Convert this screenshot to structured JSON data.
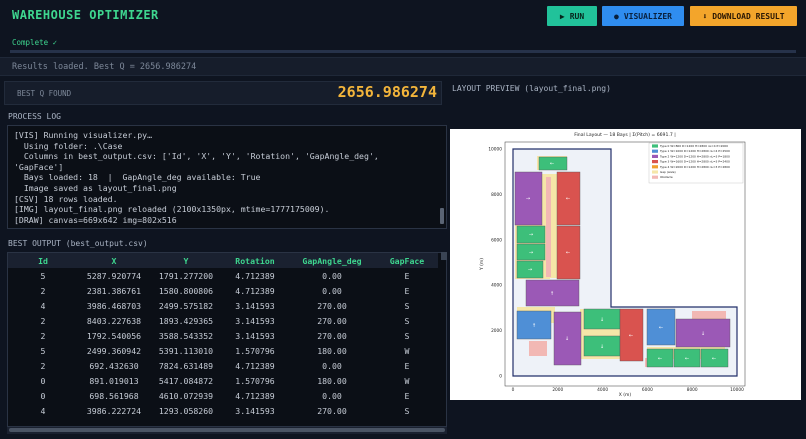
{
  "header": {
    "title": "WAREHOUSE OPTIMIZER",
    "run_label": "RUN",
    "visualizer_label": "VISUALIZER",
    "download_label": "DOWNLOAD RESULT"
  },
  "status": {
    "text": "Complete ✓",
    "progress": 1.0
  },
  "results_line": "Results loaded.  Best Q = 2656.986274",
  "best_q": {
    "label": "BEST Q FOUND",
    "value": "2656.986274"
  },
  "process_log": {
    "label": "PROCESS LOG",
    "lines": [
      "[VIS] Running visualizer.py…",
      "  Using folder: .\\Case",
      "  Columns in best_output.csv: ['Id', 'X', 'Y', 'Rotation', 'GapAngle_deg',",
      "'GapFace']",
      "  Bays loaded: 18  |  GapAngle_deg available: True",
      "  Image saved as layout_final.png",
      "[CSV] 18 rows loaded.",
      "[IMG] layout_final.png reloaded (2100x1350px, mtime=1777175009).",
      "[DRAW] canvas=669x642 img=802x516"
    ]
  },
  "best_output": {
    "label": "BEST OUTPUT  (best_output.csv)",
    "columns": [
      "Id",
      "X",
      "Y",
      "Rotation",
      "GapAngle_deg",
      "GapFace"
    ],
    "rows": [
      [
        "5",
        "5287.920774",
        "1791.277200",
        "4.712389",
        "0.00",
        "E"
      ],
      [
        "2",
        "2381.386761",
        "1580.800806",
        "4.712389",
        "0.00",
        "E"
      ],
      [
        "4",
        "3986.468703",
        "2499.575182",
        "3.141593",
        "270.00",
        "S"
      ],
      [
        "2",
        "8403.227638",
        "1893.429365",
        "3.141593",
        "270.00",
        "S"
      ],
      [
        "2",
        "1792.540056",
        "3588.543352",
        "3.141593",
        "270.00",
        "S"
      ],
      [
        "5",
        "2499.360942",
        "5391.113010",
        "1.570796",
        "180.00",
        "W"
      ],
      [
        "2",
        "692.432630",
        "7824.631489",
        "4.712389",
        "0.00",
        "E"
      ],
      [
        "0",
        "891.019013",
        "5417.084872",
        "1.570796",
        "180.00",
        "W"
      ],
      [
        "0",
        "698.561968",
        "4610.072939",
        "4.712389",
        "0.00",
        "E"
      ],
      [
        "4",
        "3986.222724",
        "1293.058260",
        "3.141593",
        "270.00",
        "S"
      ]
    ]
  },
  "preview": {
    "label": "LAYOUT PREVIEW  (layout_final.png)",
    "plot_title": "Final Layout — 18 Bays  |  Σ(Pitch) = 6691.7  |",
    "xlabel": "X (m)",
    "ylabel": "Y (m)",
    "xticks": [
      "0",
      "2000",
      "4000",
      "6000",
      "8000",
      "10000"
    ],
    "yticks": [
      "0",
      "2000",
      "4000",
      "6000",
      "8000",
      "10000"
    ],
    "legend": [
      {
        "label": "Type 0  W=800 D=1200 H=2800  nL=4  P=2000",
        "color": "#3dbf7a"
      },
      {
        "label": "Type 1  W=1000 D=1200 H=2800  nL=4  P=2500",
        "color": "#4f8fd6"
      },
      {
        "label": "Type 2  W=1200 D=1200 H=2800  nL=3  P=1800",
        "color": "#9b59b6"
      },
      {
        "label": "Type 3  W=1600 D=1200 H=2800  nL=3  P=2400",
        "color": "#d9534f"
      },
      {
        "label": "Type 4  W=2000 D=1200 H=2800  nL=3  P=2800",
        "color": "#f0a030"
      },
      {
        "label": "Gap (aisle)",
        "color": "#f5e6a8"
      },
      {
        "label": "Obstacle",
        "color": "#f2b8b4"
      }
    ]
  }
}
